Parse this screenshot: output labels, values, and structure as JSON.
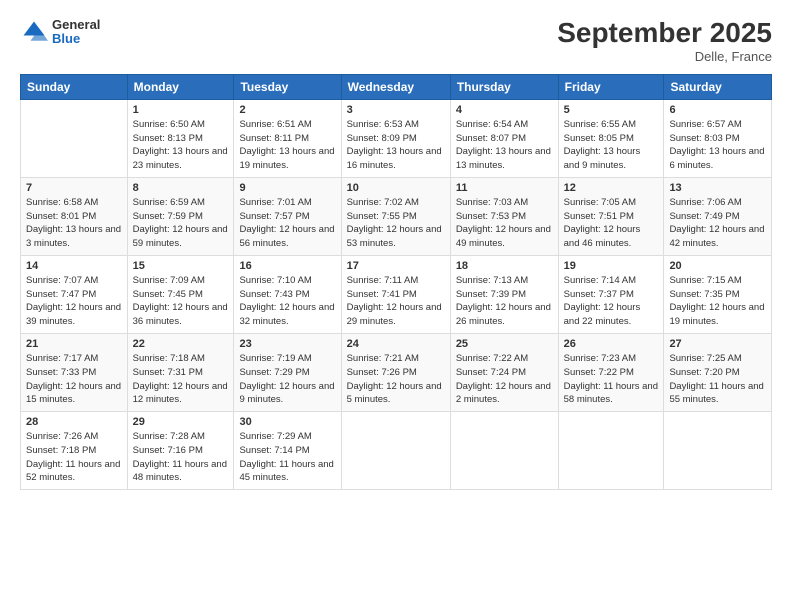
{
  "header": {
    "logo_general": "General",
    "logo_blue": "Blue",
    "month_title": "September 2025",
    "location": "Delle, France"
  },
  "days_of_week": [
    "Sunday",
    "Monday",
    "Tuesday",
    "Wednesday",
    "Thursday",
    "Friday",
    "Saturday"
  ],
  "weeks": [
    [
      {
        "day": "",
        "info": ""
      },
      {
        "day": "1",
        "info": "Sunrise: 6:50 AM\nSunset: 8:13 PM\nDaylight: 13 hours\nand 23 minutes."
      },
      {
        "day": "2",
        "info": "Sunrise: 6:51 AM\nSunset: 8:11 PM\nDaylight: 13 hours\nand 19 minutes."
      },
      {
        "day": "3",
        "info": "Sunrise: 6:53 AM\nSunset: 8:09 PM\nDaylight: 13 hours\nand 16 minutes."
      },
      {
        "day": "4",
        "info": "Sunrise: 6:54 AM\nSunset: 8:07 PM\nDaylight: 13 hours\nand 13 minutes."
      },
      {
        "day": "5",
        "info": "Sunrise: 6:55 AM\nSunset: 8:05 PM\nDaylight: 13 hours\nand 9 minutes."
      },
      {
        "day": "6",
        "info": "Sunrise: 6:57 AM\nSunset: 8:03 PM\nDaylight: 13 hours\nand 6 minutes."
      }
    ],
    [
      {
        "day": "7",
        "info": "Sunrise: 6:58 AM\nSunset: 8:01 PM\nDaylight: 13 hours\nand 3 minutes."
      },
      {
        "day": "8",
        "info": "Sunrise: 6:59 AM\nSunset: 7:59 PM\nDaylight: 12 hours\nand 59 minutes."
      },
      {
        "day": "9",
        "info": "Sunrise: 7:01 AM\nSunset: 7:57 PM\nDaylight: 12 hours\nand 56 minutes."
      },
      {
        "day": "10",
        "info": "Sunrise: 7:02 AM\nSunset: 7:55 PM\nDaylight: 12 hours\nand 53 minutes."
      },
      {
        "day": "11",
        "info": "Sunrise: 7:03 AM\nSunset: 7:53 PM\nDaylight: 12 hours\nand 49 minutes."
      },
      {
        "day": "12",
        "info": "Sunrise: 7:05 AM\nSunset: 7:51 PM\nDaylight: 12 hours\nand 46 minutes."
      },
      {
        "day": "13",
        "info": "Sunrise: 7:06 AM\nSunset: 7:49 PM\nDaylight: 12 hours\nand 42 minutes."
      }
    ],
    [
      {
        "day": "14",
        "info": "Sunrise: 7:07 AM\nSunset: 7:47 PM\nDaylight: 12 hours\nand 39 minutes."
      },
      {
        "day": "15",
        "info": "Sunrise: 7:09 AM\nSunset: 7:45 PM\nDaylight: 12 hours\nand 36 minutes."
      },
      {
        "day": "16",
        "info": "Sunrise: 7:10 AM\nSunset: 7:43 PM\nDaylight: 12 hours\nand 32 minutes."
      },
      {
        "day": "17",
        "info": "Sunrise: 7:11 AM\nSunset: 7:41 PM\nDaylight: 12 hours\nand 29 minutes."
      },
      {
        "day": "18",
        "info": "Sunrise: 7:13 AM\nSunset: 7:39 PM\nDaylight: 12 hours\nand 26 minutes."
      },
      {
        "day": "19",
        "info": "Sunrise: 7:14 AM\nSunset: 7:37 PM\nDaylight: 12 hours\nand 22 minutes."
      },
      {
        "day": "20",
        "info": "Sunrise: 7:15 AM\nSunset: 7:35 PM\nDaylight: 12 hours\nand 19 minutes."
      }
    ],
    [
      {
        "day": "21",
        "info": "Sunrise: 7:17 AM\nSunset: 7:33 PM\nDaylight: 12 hours\nand 15 minutes."
      },
      {
        "day": "22",
        "info": "Sunrise: 7:18 AM\nSunset: 7:31 PM\nDaylight: 12 hours\nand 12 minutes."
      },
      {
        "day": "23",
        "info": "Sunrise: 7:19 AM\nSunset: 7:29 PM\nDaylight: 12 hours\nand 9 minutes."
      },
      {
        "day": "24",
        "info": "Sunrise: 7:21 AM\nSunset: 7:26 PM\nDaylight: 12 hours\nand 5 minutes."
      },
      {
        "day": "25",
        "info": "Sunrise: 7:22 AM\nSunset: 7:24 PM\nDaylight: 12 hours\nand 2 minutes."
      },
      {
        "day": "26",
        "info": "Sunrise: 7:23 AM\nSunset: 7:22 PM\nDaylight: 11 hours\nand 58 minutes."
      },
      {
        "day": "27",
        "info": "Sunrise: 7:25 AM\nSunset: 7:20 PM\nDaylight: 11 hours\nand 55 minutes."
      }
    ],
    [
      {
        "day": "28",
        "info": "Sunrise: 7:26 AM\nSunset: 7:18 PM\nDaylight: 11 hours\nand 52 minutes."
      },
      {
        "day": "29",
        "info": "Sunrise: 7:28 AM\nSunset: 7:16 PM\nDaylight: 11 hours\nand 48 minutes."
      },
      {
        "day": "30",
        "info": "Sunrise: 7:29 AM\nSunset: 7:14 PM\nDaylight: 11 hours\nand 45 minutes."
      },
      {
        "day": "",
        "info": ""
      },
      {
        "day": "",
        "info": ""
      },
      {
        "day": "",
        "info": ""
      },
      {
        "day": "",
        "info": ""
      }
    ]
  ]
}
